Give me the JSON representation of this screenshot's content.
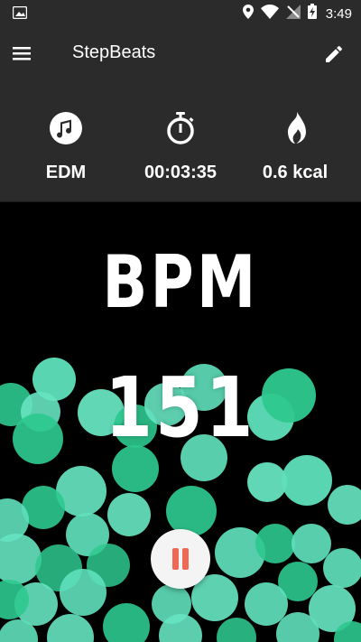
{
  "status_bar": {
    "time": "3:49"
  },
  "app_bar": {
    "title": "StepBeats"
  },
  "stats": [
    {
      "icon": "music-note-icon",
      "value": "EDM"
    },
    {
      "icon": "stopwatch-icon",
      "value": "00:03:35"
    },
    {
      "icon": "flame-icon",
      "value": "0.6 kcal"
    }
  ],
  "tempo": {
    "label": "BPM",
    "value": "151"
  },
  "colors": {
    "bar_background": "#2b2b2b",
    "bubble_light": "#5fe0bb",
    "bubble_dark": "#2ec98f",
    "pause_accent": "#ef6a55"
  }
}
